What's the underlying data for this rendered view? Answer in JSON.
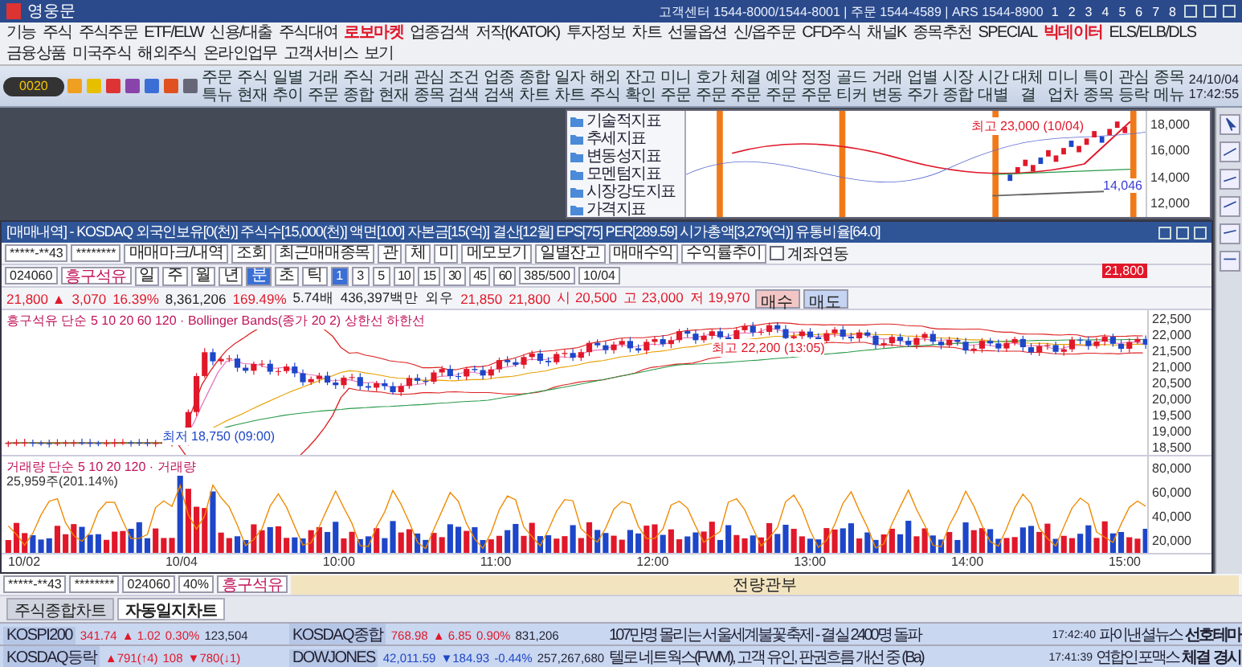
{
  "window": {
    "title": "영웅문",
    "contact": "고객센터 1544-8000/1544-8001 | 주문 1544-4589 | ARS 1544-8900",
    "pages": [
      "1",
      "2",
      "3",
      "4",
      "5",
      "6",
      "7",
      "8"
    ]
  },
  "menu": [
    {
      "label": "기능",
      "highlighted": false
    },
    {
      "label": "주식",
      "highlighted": false
    },
    {
      "label": "주식주문",
      "highlighted": false
    },
    {
      "label": "ETF/ELW",
      "highlighted": false
    },
    {
      "label": "신용/대출",
      "highlighted": false
    },
    {
      "label": "주식대여",
      "highlighted": false
    },
    {
      "label": "로보마켓",
      "highlighted": true
    },
    {
      "label": "업종검색",
      "highlighted": false
    },
    {
      "label": "저작(KATOK)",
      "highlighted": false
    },
    {
      "label": "투자정보",
      "highlighted": false
    },
    {
      "label": "차트",
      "highlighted": false
    },
    {
      "label": "선물옵션",
      "highlighted": false
    },
    {
      "label": "신/옵주문",
      "highlighted": false
    },
    {
      "label": "CFD주식",
      "highlighted": false
    },
    {
      "label": "채널K",
      "highlighted": false
    },
    {
      "label": "종목추천",
      "highlighted": false
    },
    {
      "label": "SPECIAL",
      "highlighted": false
    },
    {
      "label": "빅데이터",
      "highlighted": true
    },
    {
      "label": "ELS/ELB/DLS",
      "highlighted": false
    },
    {
      "label": "금융상품",
      "highlighted": false
    },
    {
      "label": "미국주식",
      "highlighted": false
    },
    {
      "label": "해외주식",
      "highlighted": false
    },
    {
      "label": "온라인업무",
      "highlighted": false
    },
    {
      "label": "고객서비스",
      "highlighted": false
    },
    {
      "label": "보기",
      "highlighted": false
    }
  ],
  "toolbar": {
    "screen_number": "0020",
    "buttons": [
      [
        "주문",
        "특뉴"
      ],
      [
        "주식",
        "현재"
      ],
      [
        "일별",
        "추이"
      ],
      [
        "거래",
        "주문"
      ],
      [
        "주식",
        "종합"
      ],
      [
        "거래",
        "현재"
      ],
      [
        "관심",
        "종목"
      ],
      [
        "조건",
        "검색"
      ],
      [
        "업종",
        "검색"
      ],
      [
        "종합",
        "차트"
      ],
      [
        "일자",
        "차트"
      ],
      [
        "해외",
        "주식"
      ],
      [
        "잔고",
        "확인"
      ],
      [
        "미니",
        "주문"
      ],
      [
        "호가",
        "주문"
      ],
      [
        "체결",
        "주문"
      ],
      [
        "예약",
        "주문"
      ],
      [
        "정정",
        "주문"
      ],
      [
        "골드",
        "티커"
      ],
      [
        "거래",
        "변동"
      ],
      [
        "업별",
        "주가"
      ],
      [
        "시장",
        "종합"
      ],
      [
        "시간",
        "대별"
      ],
      [
        "대체",
        "결"
      ],
      [
        "미니",
        "업차"
      ],
      [
        "특이",
        "종목"
      ],
      [
        "관심",
        "등락"
      ],
      [
        "종목",
        "메뉴"
      ]
    ],
    "date": "24/10/04",
    "time": "17:42:55"
  },
  "back_window": {
    "indicator_groups": [
      "기술적지표",
      "추세지표",
      "변동성지표",
      "모멘텀지표",
      "시장강도지표",
      "가격지표"
    ],
    "high_label": "최고 23,000 (10/04)",
    "price_label": "14,046",
    "yticks": [
      "18,000",
      "16,000",
      "14,000",
      "12,000"
    ]
  },
  "chart_window": {
    "title": "[매매내역] - KOSDAQ 외국인보유[0(천)] 주식수[15,000(천)] 액면[100] 자본금[15(억)] 결산[12월] EPS[75] PER[289.59] 시가총액[3,279(억)] 유통비율[64.0]",
    "account": "*****-**43",
    "password": "********",
    "actions": [
      "매매마크/내역",
      "조회",
      "최근매매종목",
      "관",
      "체",
      "미",
      "메모보기",
      "일별잔고",
      "매매수익",
      "수익률추이"
    ],
    "link_account": {
      "label": "계좌연동",
      "checked": false
    },
    "code": "024060",
    "name": "흥구석유",
    "periods": [
      {
        "label": "일",
        "selected": false
      },
      {
        "label": "주",
        "selected": false
      },
      {
        "label": "월",
        "selected": false
      },
      {
        "label": "년",
        "selected": false
      },
      {
        "label": "분",
        "selected": true
      },
      {
        "label": "초",
        "selected": false
      },
      {
        "label": "틱",
        "selected": false
      }
    ],
    "intervals": [
      {
        "label": "1",
        "selected": true
      },
      {
        "label": "3",
        "selected": false
      },
      {
        "label": "5",
        "selected": false
      },
      {
        "label": "10",
        "selected": false
      },
      {
        "label": "15",
        "selected": false
      },
      {
        "label": "30",
        "selected": false
      },
      {
        "label": "45",
        "selected": false
      },
      {
        "label": "60",
        "selected": false
      }
    ],
    "count": "385/500",
    "chart_date": "10/04",
    "quote": [
      {
        "text": "21,800 ▲",
        "kind": "up"
      },
      {
        "text": "3,070",
        "kind": "up"
      },
      {
        "text": "16.39%",
        "kind": "up"
      },
      {
        "text": "8,361,206",
        "kind": "plain"
      },
      {
        "text": "169.49%",
        "kind": "up"
      },
      {
        "text": "5.74배",
        "kind": "plain"
      },
      {
        "text": "436,397백만",
        "kind": "plain"
      },
      {
        "text": "외우",
        "kind": "plain"
      },
      {
        "text": "21,850",
        "kind": "up"
      },
      {
        "text": "21,800",
        "kind": "up"
      },
      {
        "text": "시 20,500",
        "kind": "up"
      },
      {
        "text": "고 23,000",
        "kind": "up"
      },
      {
        "text": "저 19,970",
        "kind": "up"
      }
    ],
    "trade_buttons": [
      {
        "label": "매수",
        "kind": "buy"
      },
      {
        "label": "매도",
        "kind": "sell"
      }
    ],
    "price_legend": "흥구석유 단순 5 10 20 60 120 · Bollinger Bands(종가 20 2) 상한선 하한선",
    "high_label": "최고 22,200 (13:05)",
    "low_label": "최저 18,750 (09:00)",
    "current_price": "21,800",
    "yticks": [
      "22,500",
      "22,000",
      "21,500",
      "21,000",
      "20,500",
      "20,000",
      "19,500",
      "19,000",
      "18,500"
    ],
    "volume_legend": "거래량 단순 5 10 20 120 · 거래량",
    "volume_reading": "25,959주(201.14%)",
    "volume_yticks": [
      "80,000",
      "60,000",
      "40,000",
      "20,000"
    ],
    "xticks": [
      "10/02",
      "10/04",
      "10:00",
      "11:00",
      "12:00",
      "13:00",
      "14:00",
      "15:00"
    ]
  },
  "order_bar": {
    "account": "*****-**43",
    "password": "********",
    "code": "024060",
    "ratio": "40%",
    "name": "흥구석유",
    "status": "전량관부"
  },
  "tabs": [
    {
      "label": "주식종합차트",
      "selected": false
    },
    {
      "label": "자동일지차트",
      "selected": true
    }
  ],
  "tickers": [
    [
      {
        "name": "KOSPI200",
        "value": "341.74",
        "change": "▲ 1.02",
        "rate": "0.30%",
        "volume": "123,504",
        "color": "#e0182a"
      },
      {
        "name": "KOSDAQ종합",
        "value": "768.98",
        "change": "▲ 6.85",
        "rate": "0.90%",
        "volume": "831,206",
        "color": "#e0182a"
      }
    ],
    [
      {
        "name": "KOSDAQ등락",
        "value": "▲791(↑4)",
        "change": "108",
        "rate": "▼780(↓1)",
        "color": "#e0182a"
      },
      {
        "name": "DOWJONES",
        "value": "42,011.59",
        "change": "▼184.93",
        "rate": "-0.44%",
        "volume": "257,267,680",
        "color": "#1d46c8"
      }
    ]
  ],
  "news": [
    {
      "headline": "107만명 몰리는 서울세계불꽃축제 - 결실 2400명 돌파",
      "time": "17:42:40",
      "source": "파이낸셜뉴스"
    },
    {
      "headline": "텔로 네트웍스(FWM), 고객 유인, 판권흐름 개선 중 (Ba)",
      "time": "17:41:39",
      "source": "연합인포맥스"
    }
  ],
  "news_actions": [
    "선호테마",
    "체결",
    "경시"
  ]
}
